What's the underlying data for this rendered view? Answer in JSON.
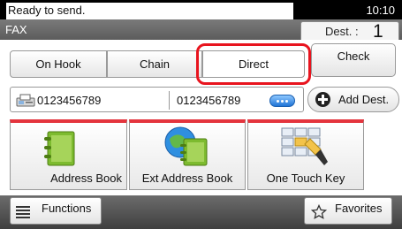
{
  "status": {
    "message": "Ready to send.",
    "time": "10:10"
  },
  "mode": {
    "title": "FAX",
    "dest_label": "Dest. :",
    "dest_count": "1"
  },
  "tabs": [
    {
      "label": "On Hook"
    },
    {
      "label": "Chain"
    },
    {
      "label": "Direct",
      "selected": true
    }
  ],
  "check_label": "Check",
  "destination": {
    "number_left": "0123456789",
    "number_right": "0123456789"
  },
  "add_dest_label": "Add Dest.",
  "tiles": [
    {
      "label": "Address Book",
      "icon": "address-book-icon"
    },
    {
      "label": "Ext Address Book",
      "icon": "ext-address-book-icon"
    },
    {
      "label": "One Touch Key",
      "icon": "one-touch-key-icon"
    }
  ],
  "functions_label": "Functions",
  "favorites_label": "Favorites",
  "colors": {
    "highlight": "#e8141e",
    "tile_top": "#e4343d",
    "accent_blue": "#1f74d6"
  }
}
